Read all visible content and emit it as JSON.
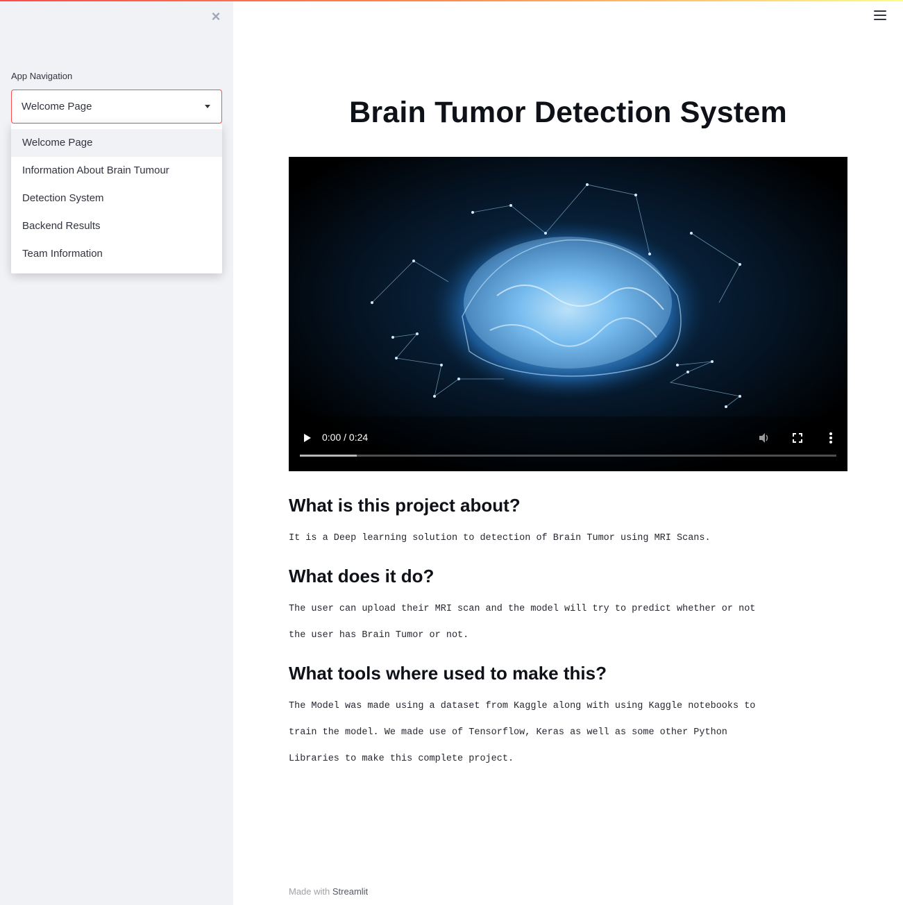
{
  "sidebar": {
    "nav_label": "App Navigation",
    "selected": "Welcome Page",
    "options": [
      "Welcome Page",
      "Information About Brain Tumour",
      "Detection System",
      "Backend Results",
      "Team Information"
    ],
    "close_icon": "close-icon"
  },
  "header": {
    "menu_icon": "hamburger-menu-icon"
  },
  "main": {
    "title": "Brain Tumor Detection System",
    "video": {
      "time": "0:00 / 0:24",
      "buffered_fraction": 0.106,
      "icons": [
        "play-icon",
        "volume-icon",
        "fullscreen-icon",
        "more-options-icon"
      ]
    },
    "sections": [
      {
        "heading": "What is this project about?",
        "lines": [
          "It is a Deep learning solution to detection of Brain Tumor using MRI Scans."
        ]
      },
      {
        "heading": "What does it do?",
        "lines": [
          "The user can upload their MRI scan and the model will try to predict whether or not",
          "the user has Brain Tumor or not."
        ]
      },
      {
        "heading": "What tools where used to make this?",
        "lines": [
          "The Model was made using a dataset from Kaggle along with using Kaggle notebooks to",
          "train the model. We made use of Tensorflow, Keras as well as some other Python",
          "Libraries to make this complete project."
        ]
      }
    ]
  },
  "footer": {
    "prefix": "Made with",
    "brand": "Streamlit"
  },
  "colors": {
    "accent": "#ff4b4b",
    "sidebar_bg": "#f0f2f6"
  }
}
